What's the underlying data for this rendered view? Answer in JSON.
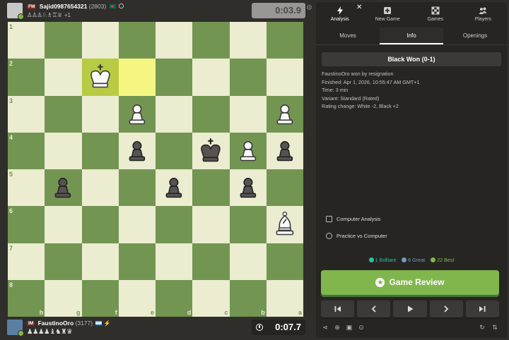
{
  "top_player": {
    "title": "FM",
    "name": "Sajid0987654321",
    "rating": "(2803)",
    "captured": "♙♙♙♘♗♖♕",
    "material_diff": "+1",
    "clock": "0:03.9"
  },
  "bottom_player": {
    "title": "IM",
    "name": "FaustinoOro",
    "rating": "(3177)",
    "captured": "♟♟♟♟♝♞♜♛",
    "clock": "0:07.7"
  },
  "board": {
    "orientation": "black",
    "rank_labels": [
      "1",
      "2",
      "3",
      "4",
      "5",
      "6",
      "7",
      "8"
    ],
    "file_labels": [
      "h",
      "g",
      "f",
      "e",
      "d",
      "c",
      "b",
      "a"
    ],
    "highlighted_squares": [
      "f2",
      "e2"
    ],
    "pieces": [
      {
        "square": "f2",
        "piece": "K",
        "color": "white"
      },
      {
        "square": "e3",
        "piece": "P",
        "color": "white"
      },
      {
        "square": "a3",
        "piece": "P",
        "color": "white"
      },
      {
        "square": "e4",
        "piece": "P",
        "color": "black"
      },
      {
        "square": "c4",
        "piece": "K",
        "color": "black"
      },
      {
        "square": "b4",
        "piece": "P",
        "color": "white"
      },
      {
        "square": "a4",
        "piece": "P",
        "color": "black"
      },
      {
        "square": "g5",
        "piece": "P",
        "color": "black"
      },
      {
        "square": "d5",
        "piece": "P",
        "color": "black"
      },
      {
        "square": "b5",
        "piece": "P",
        "color": "black"
      },
      {
        "square": "a6",
        "piece": "B",
        "color": "white"
      }
    ]
  },
  "panel": {
    "nav_tabs": [
      {
        "label": "Analysis",
        "icon": "lightning-icon",
        "active": true
      },
      {
        "label": "New Game",
        "icon": "plus-box-icon",
        "active": false
      },
      {
        "label": "Games",
        "icon": "checkerboard-icon",
        "active": false
      },
      {
        "label": "Players",
        "icon": "players-icon",
        "active": false
      }
    ],
    "sub_tabs": [
      {
        "label": "Moves",
        "active": false
      },
      {
        "label": "Info",
        "active": true
      },
      {
        "label": "Openings",
        "active": false
      }
    ],
    "result": "Black Won (0-1)",
    "info": [
      "FaustinoOro won by resignation",
      "Finished: Apr 1, 2026, 10:55:47 AM GMT+1",
      "Time: 3 min",
      "Variant: Standard (Rated)",
      "Rating change: White -2, Black +2"
    ],
    "tools": [
      {
        "label": "Computer Analysis",
        "icon": "analysis-icon"
      },
      {
        "label": "Practice vs Computer",
        "icon": "target-icon"
      }
    ],
    "stats": [
      {
        "label": "1 Brilliant",
        "color": "#26c2a3"
      },
      {
        "label": "6 Great",
        "color": "#749bbf"
      },
      {
        "label": "22 Best",
        "color": "#81b64c"
      }
    ],
    "review_button": "Game Review",
    "accent": "#81b64c"
  }
}
